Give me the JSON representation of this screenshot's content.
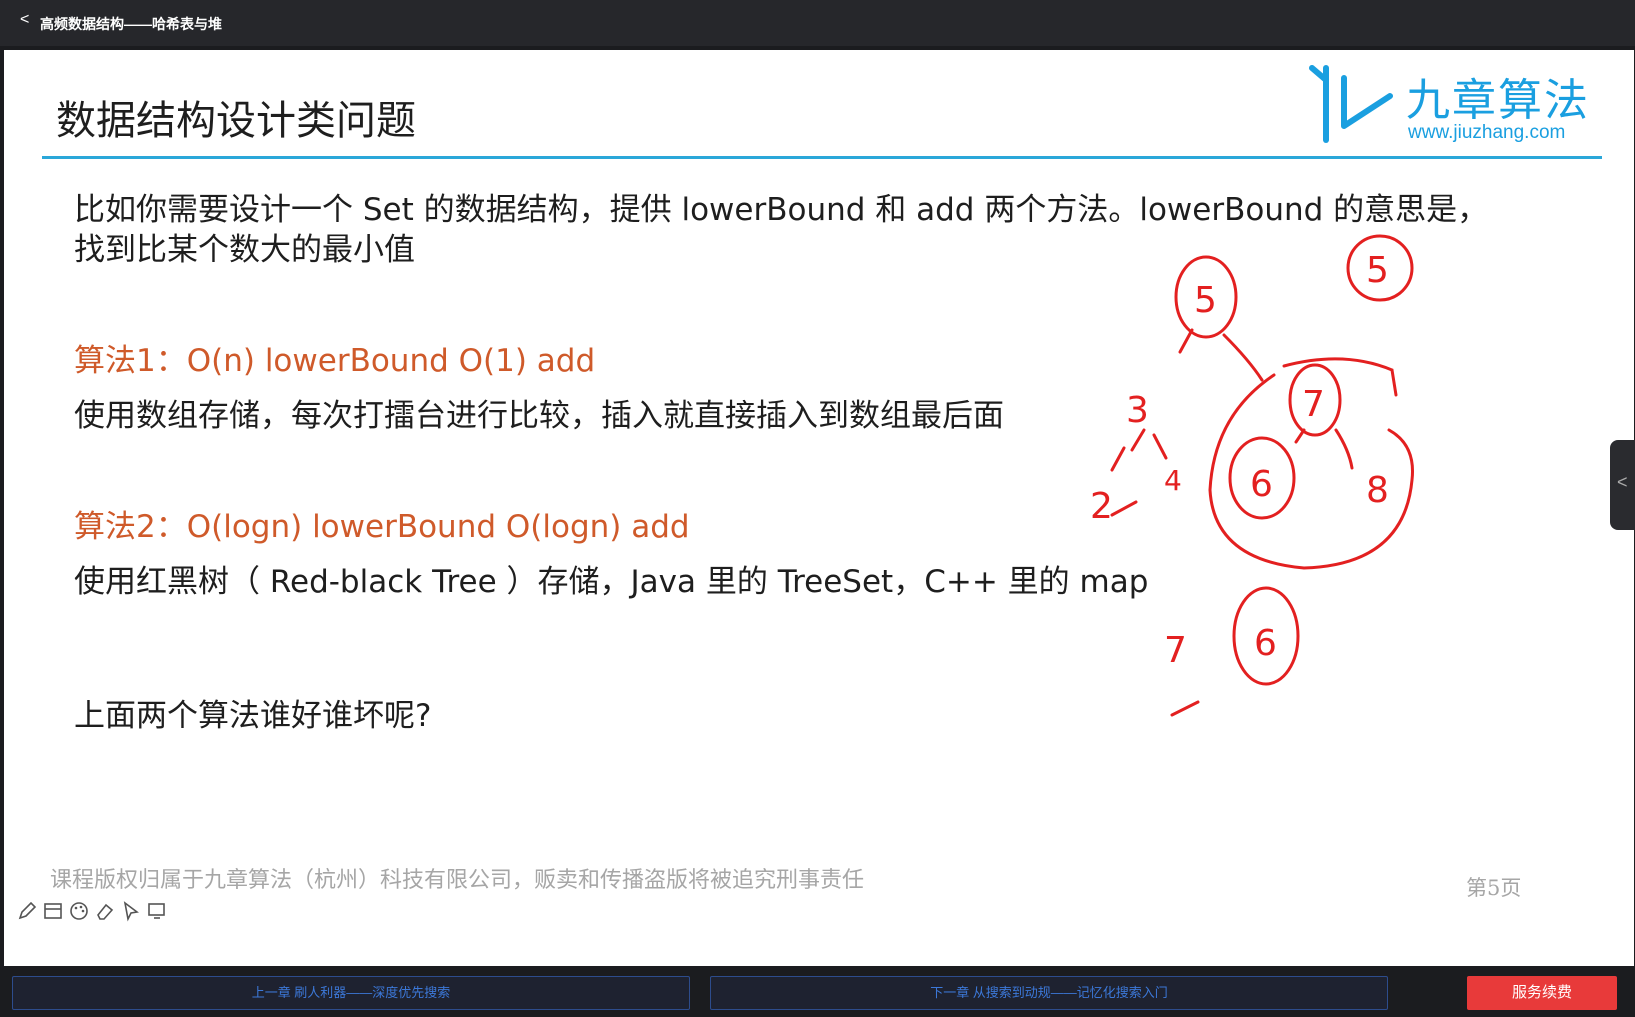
{
  "window": {
    "back_glyph": "<",
    "title": "高频数据结构——哈希表与堆"
  },
  "slide": {
    "title": "数据结构设计类问题",
    "logo": {
      "brand": "九章算法",
      "url": "www.jiuzhang.com"
    },
    "intro_line1": "比如你需要设计一个 Set 的数据结构，提供 lowerBound 和 add 两个方法。lowerBound 的意思是，",
    "intro_line2": " 找到比某个数大的最小值",
    "algo1_title": "算法1：O(n) lowerBound O(1) add",
    "algo1_desc": "使用数组存储，每次打擂台进行比较，插入就直接插入到数组最后面",
    "algo2_title": "算法2：O(logn) lowerBound O(logn) add",
    "algo2_desc": "使用红黑树（ Red-black Tree ）存储，Java 里的 TreeSet，C++ 里的 map",
    "question": "上面两个算法谁好谁坏呢?",
    "copyright": "课程版权归属于九章算法（杭州）科技有限公司，贩卖和传播盗版将被追究刑事责任",
    "page_number": "第5页",
    "ink_color": "#e32020",
    "ink_labels": [
      "5",
      "5",
      "7",
      "6",
      "8",
      "3",
      "4",
      "2",
      "6",
      "7"
    ]
  },
  "toolbar": {
    "icons": [
      "pencil-icon",
      "whiteboard-icon",
      "palette-icon",
      "eraser-icon",
      "pointer-icon",
      "screen-icon"
    ]
  },
  "side_tab_glyph": "<",
  "bottom": {
    "prev_label": "上一章 刷人利器——深度优先搜索",
    "next_label": "下一章 从搜索到动规——记忆化搜索入门",
    "renew_label": "服务续费"
  },
  "colors": {
    "accent_blue": "#1a9fe0",
    "algo_orange": "#cf5a2a",
    "renew_red": "#e83a3a"
  }
}
